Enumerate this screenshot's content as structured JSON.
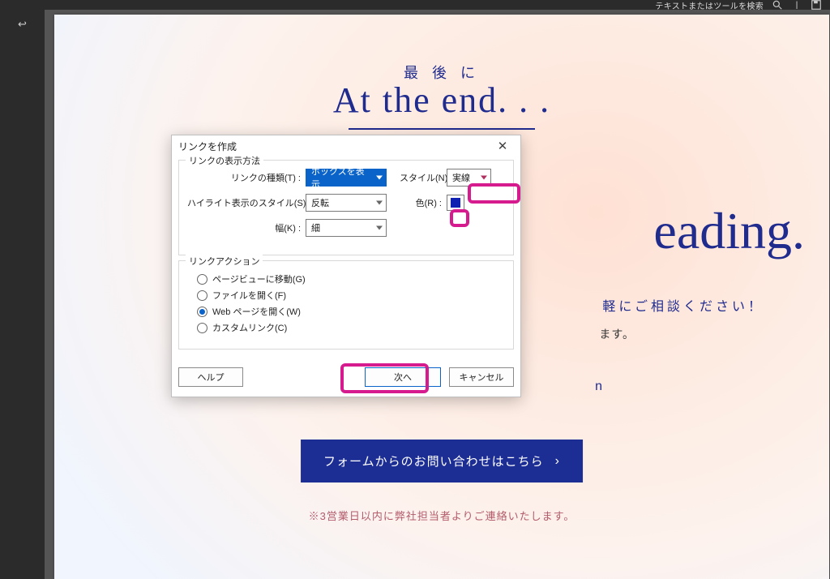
{
  "topbar": {
    "search_placeholder": "テキストまたはツールを検索"
  },
  "page": {
    "subtitle": "最 後 に",
    "title": "At the end. . .",
    "big_serif": "eading.",
    "consult": "軽にご相談ください！",
    "masu": "ます。",
    "small_link": "n",
    "cta": "フォームからのお問い合わせはこちら",
    "note": "※3営業日以内に弊社担当者よりご連絡いたします。"
  },
  "dialog": {
    "title": "リンクを作成",
    "group1": {
      "label": "リンクの表示方法",
      "link_type_label": "リンクの種類(T) :",
      "link_type_value": "ボックスを表示",
      "highlight_label": "ハイライト表示のスタイル(S) :",
      "highlight_value": "反転",
      "width_label": "幅(K) :",
      "width_value": "細",
      "style_label": "スタイル(N) :",
      "style_value": "実線",
      "color_label": "色(R) :",
      "color_value": "#1020b0"
    },
    "group2": {
      "label": "リンクアクション",
      "r1": "ページビューに移動(G)",
      "r2": "ファイルを開く(F)",
      "r3": "Web ページを開く(W)",
      "r4": "カスタムリンク(C)"
    },
    "help": "ヘルプ",
    "next": "次へ",
    "cancel": "キャンセル"
  }
}
